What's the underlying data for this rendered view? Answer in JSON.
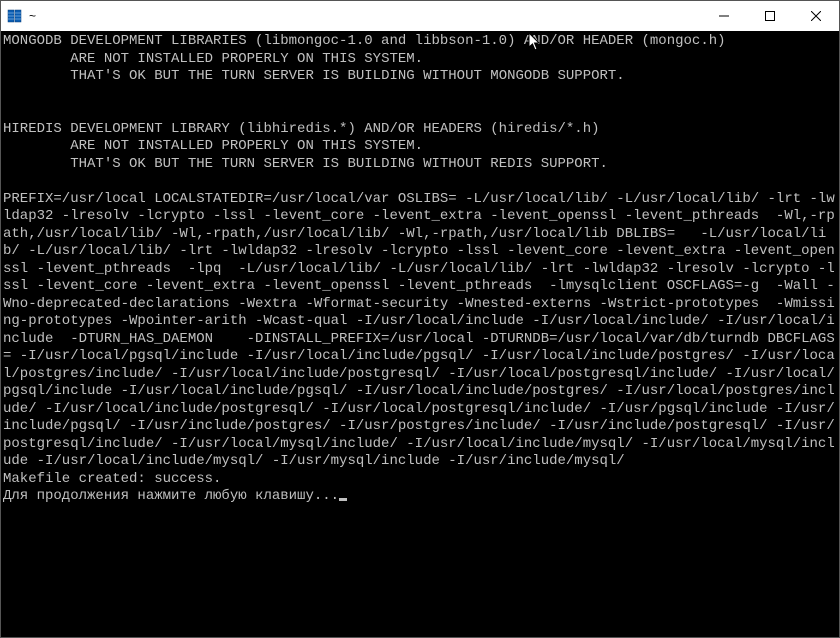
{
  "window": {
    "title": "~"
  },
  "terminal": {
    "lines": [
      "MONGODB DEVELOPMENT LIBRARIES (libmongoc-1.0 and libbson-1.0) AND/OR HEADER (mongoc.h)",
      "        ARE NOT INSTALLED PROPERLY ON THIS SYSTEM.",
      "        THAT'S OK BUT THE TURN SERVER IS BUILDING WITHOUT MONGODB SUPPORT.",
      "",
      "",
      "HIREDIS DEVELOPMENT LIBRARY (libhiredis.*) AND/OR HEADERS (hiredis/*.h)",
      "        ARE NOT INSTALLED PROPERLY ON THIS SYSTEM.",
      "        THAT'S OK BUT THE TURN SERVER IS BUILDING WITHOUT REDIS SUPPORT.",
      "",
      "PREFIX=/usr/local LOCALSTATEDIR=/usr/local/var OSLIBS= -L/usr/local/lib/ -L/usr/local/lib/ -lrt -lwldap32 -lresolv -lcrypto -lssl -levent_core -levent_extra -levent_openssl -levent_pthreads  -Wl,-rpath,/usr/local/lib/ -Wl,-rpath,/usr/local/lib/ -Wl,-rpath,/usr/local/lib DBLIBS=   -L/usr/local/lib/ -L/usr/local/lib/ -lrt -lwldap32 -lresolv -lcrypto -lssl -levent_core -levent_extra -levent_openssl -levent_pthreads  -lpq  -L/usr/local/lib/ -L/usr/local/lib/ -lrt -lwldap32 -lresolv -lcrypto -lssl -levent_core -levent_extra -levent_openssl -levent_pthreads  -lmysqlclient OSCFLAGS=-g  -Wall -Wno-deprecated-declarations -Wextra -Wformat-security -Wnested-externs -Wstrict-prototypes  -Wmissing-prototypes -Wpointer-arith -Wcast-qual -I/usr/local/include -I/usr/local/include/ -I/usr/local/include  -DTURN_HAS_DAEMON    -DINSTALL_PREFIX=/usr/local -DTURNDB=/usr/local/var/db/turndb DBCFLAGS= -I/usr/local/pgsql/include -I/usr/local/include/pgsql/ -I/usr/local/include/postgres/ -I/usr/local/postgres/include/ -I/usr/local/include/postgresql/ -I/usr/local/postgresql/include/ -I/usr/local/pgsql/include -I/usr/local/include/pgsql/ -I/usr/local/include/postgres/ -I/usr/local/postgres/include/ -I/usr/local/include/postgresql/ -I/usr/local/postgresql/include/ -I/usr/pgsql/include -I/usr/include/pgsql/ -I/usr/include/postgres/ -I/usr/postgres/include/ -I/usr/include/postgresql/ -I/usr/postgresql/include/ -I/usr/local/mysql/include/ -I/usr/local/include/mysql/ -I/usr/local/mysql/include -I/usr/local/include/mysql/ -I/usr/mysql/include -I/usr/include/mysql/",
      "Makefile created: success."
    ],
    "prompt_line": "Для продолжения нажмите любую клавишу..."
  }
}
